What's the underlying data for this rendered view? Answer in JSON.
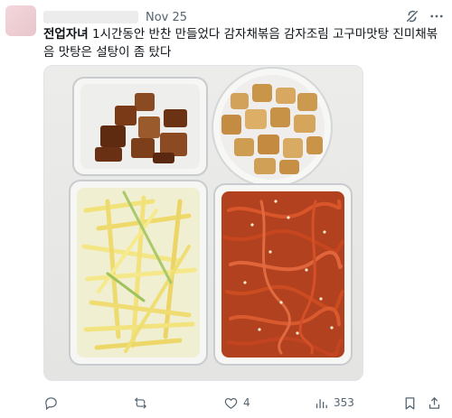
{
  "post": {
    "date": "Nov 25",
    "nickname": "전업자녀",
    "body": " 1시간동안 반찬 만들었다 감자채볶음 감자조림 고구마맛탕 진미채볶음 맛탕은 설탕이 좀 탔다",
    "image_alt": ""
  },
  "actions": {
    "reply_count": "",
    "repost_count": "",
    "like_count": "4",
    "view_count": "353"
  },
  "icons": {
    "grok": "grok-icon",
    "more": "more-icon",
    "reply": "reply-icon",
    "repost": "repost-icon",
    "like": "heart-icon",
    "views": "views-icon",
    "bookmark": "bookmark-icon",
    "share": "share-icon"
  },
  "colors": {
    "text": "#0f1419",
    "muted": "#536471"
  }
}
